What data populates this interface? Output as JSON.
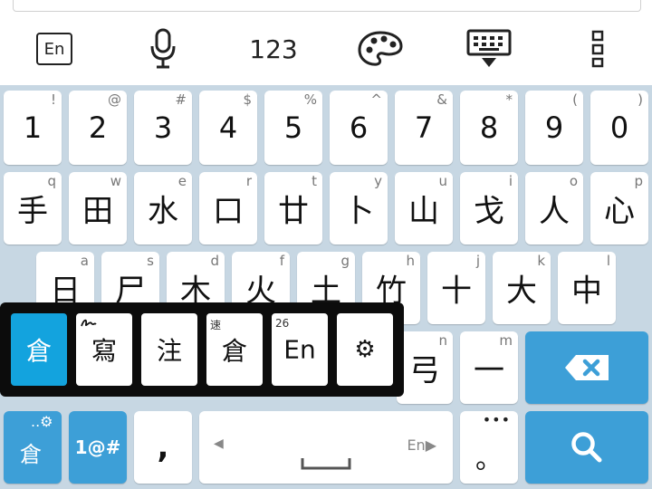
{
  "toolbar": {
    "lang_label": "En",
    "num_label": "123",
    "icons": [
      "mic-icon",
      "palette-icon",
      "keyboard-hide-icon",
      "more-vert-icon"
    ]
  },
  "rows": {
    "numbers": [
      {
        "main": "1",
        "hint": "!"
      },
      {
        "main": "2",
        "hint": "@"
      },
      {
        "main": "3",
        "hint": "#"
      },
      {
        "main": "4",
        "hint": "$"
      },
      {
        "main": "5",
        "hint": "%"
      },
      {
        "main": "6",
        "hint": "^"
      },
      {
        "main": "7",
        "hint": "&"
      },
      {
        "main": "8",
        "hint": "*"
      },
      {
        "main": "9",
        "hint": "("
      },
      {
        "main": "0",
        "hint": ")"
      }
    ],
    "row1": [
      {
        "main": "手",
        "hint": "q"
      },
      {
        "main": "田",
        "hint": "w"
      },
      {
        "main": "水",
        "hint": "e"
      },
      {
        "main": "口",
        "hint": "r"
      },
      {
        "main": "廿",
        "hint": "t"
      },
      {
        "main": "卜",
        "hint": "y"
      },
      {
        "main": "山",
        "hint": "u"
      },
      {
        "main": "戈",
        "hint": "i"
      },
      {
        "main": "人",
        "hint": "o"
      },
      {
        "main": "心",
        "hint": "p"
      }
    ],
    "row2": [
      {
        "main": "日",
        "hint": "a"
      },
      {
        "main": "尸",
        "hint": "s"
      },
      {
        "main": "木",
        "hint": "d"
      },
      {
        "main": "火",
        "hint": "f"
      },
      {
        "main": "土",
        "hint": "g"
      },
      {
        "main": "竹",
        "hint": "h"
      },
      {
        "main": "十",
        "hint": "j"
      },
      {
        "main": "大",
        "hint": "k"
      },
      {
        "main": "中",
        "hint": "l"
      }
    ],
    "row3": [
      {
        "main": "弓",
        "hint": "n"
      },
      {
        "main": "一",
        "hint": "m"
      }
    ]
  },
  "bottom": {
    "mode_label": "倉",
    "symbols_label": "1@#",
    "comma": ",",
    "space_lang": "En",
    "period": "。"
  },
  "popup": {
    "items": [
      {
        "main": "倉",
        "small": ""
      },
      {
        "main": "寫",
        "small": ""
      },
      {
        "main": "注",
        "small": ""
      },
      {
        "main": "倉",
        "small": "速"
      },
      {
        "main": "En",
        "small": "26"
      },
      {
        "main": "⚙",
        "small": ""
      }
    ]
  },
  "colors": {
    "keyboard_bg": "#c7d7e3",
    "accent_blue": "#3d9fd7",
    "popup_active": "#13a3de"
  }
}
